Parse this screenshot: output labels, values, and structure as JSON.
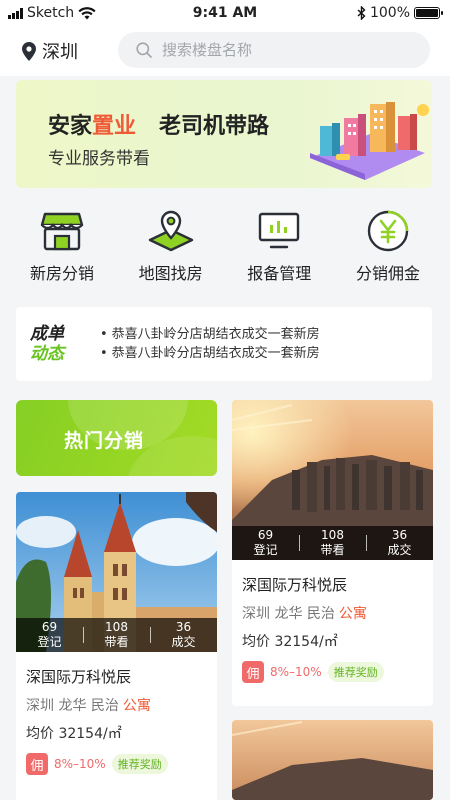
{
  "status_bar": {
    "carrier": "Sketch",
    "time": "9:41 AM",
    "battery": "100%"
  },
  "header": {
    "city": "深圳",
    "search_placeholder": "搜索楼盘名称"
  },
  "banner": {
    "title_part1": "安家",
    "title_accent": "置业",
    "title_part2": "老司机带路",
    "subtitle": "专业服务带看",
    "accent_color": "#ef5a37"
  },
  "quick_nav": [
    {
      "label": "新房分销",
      "icon": "storefront-icon"
    },
    {
      "label": "地图找房",
      "icon": "map-pin-icon"
    },
    {
      "label": "报备管理",
      "icon": "monitor-chart-icon"
    },
    {
      "label": "分销佣金",
      "icon": "yen-coin-icon"
    }
  ],
  "deals": {
    "tag_line1": "成单",
    "tag_line2": "动态",
    "items": [
      "恭喜八卦岭分店胡结衣成交一套新房",
      "恭喜八卦岭分店胡结衣成交一套新房"
    ]
  },
  "hot_card": {
    "label": "热门分销",
    "color": "#8fd224"
  },
  "listings": [
    {
      "stats": [
        {
          "value": "69",
          "label": "登记"
        },
        {
          "value": "108",
          "label": "带看"
        },
        {
          "value": "36",
          "label": "成交"
        }
      ],
      "name": "深国际万科悦辰",
      "location": "深圳 龙华 民治",
      "type": "公寓",
      "price": "均价 32154/㎡",
      "commission_badge": "佣",
      "commission_rate": "8%–10%",
      "reward": "推荐奖励"
    },
    {
      "stats": [
        {
          "value": "69",
          "label": "登记"
        },
        {
          "value": "108",
          "label": "带看"
        },
        {
          "value": "36",
          "label": "成交"
        }
      ],
      "name": "深国际万科悦辰",
      "location": "深圳 龙华 民治",
      "type": "公寓",
      "price": "均价 32154/㎡",
      "commission_badge": "佣",
      "commission_rate": "8%–10%",
      "reward": "推荐奖励"
    }
  ]
}
